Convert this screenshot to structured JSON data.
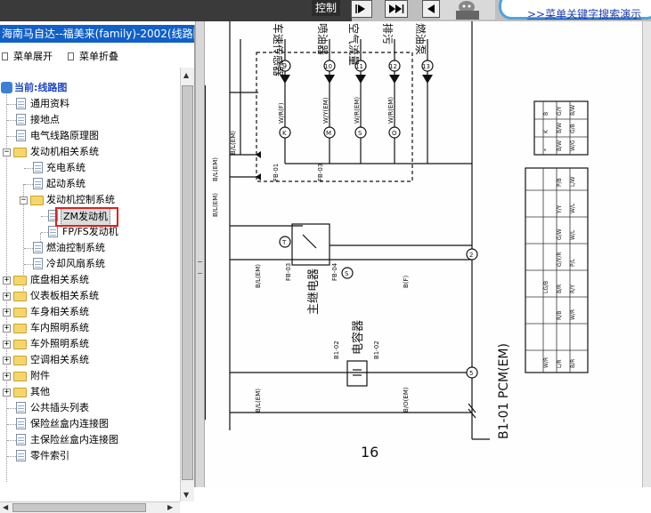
{
  "toolbar": {
    "control_label": "控制",
    "search_link": ">>菜单关键字搜索演示",
    "nav_icons": [
      "next-page-icon",
      "last-page-icon",
      "prev-page-icon"
    ]
  },
  "left_panel": {
    "title": "海南马自达--福美来(family)-2002(线路图)",
    "expand_label": "菜单展开",
    "collapse_label": "菜单折叠",
    "tree": {
      "root": "当前:线路图",
      "items": [
        {
          "label": "通用资料"
        },
        {
          "label": "接地点"
        },
        {
          "label": "电气线路原理图"
        },
        {
          "label": "发动机相关系统"
        },
        {
          "label": "充电系统"
        },
        {
          "label": "起动系统"
        },
        {
          "label": "发动机控制系统"
        },
        {
          "label": "ZM发动机"
        },
        {
          "label": "FP/FS发动机"
        },
        {
          "label": "燃油控制系统"
        },
        {
          "label": "冷却风扇系统"
        },
        {
          "label": "底盘相关系统"
        },
        {
          "label": "仪表板相关系统"
        },
        {
          "label": "车身相关系统"
        },
        {
          "label": "车内照明系统"
        },
        {
          "label": "车外照明系统"
        },
        {
          "label": "空调相关系统"
        },
        {
          "label": "附件"
        },
        {
          "label": "其他"
        },
        {
          "label": "公共插头列表"
        },
        {
          "label": "保险丝盒内连接图"
        },
        {
          "label": "主保险丝盒内连接图"
        },
        {
          "label": "零件索引"
        }
      ]
    }
  },
  "diagram": {
    "page_number": "16",
    "pcm_label": "B1-01 PCM(EM)",
    "relay_label": "主继电器",
    "capacitor_label": "电容器",
    "connectors": [
      "FB-01",
      "FB-03",
      "FB-04",
      "B1-02",
      "B1-02"
    ],
    "circles": [
      "9",
      "10",
      "11",
      "12",
      "13",
      "K",
      "M",
      "S",
      "O",
      "T",
      "S",
      "5",
      "2"
    ],
    "wire_labels": [
      "B/L(EM)",
      "B/L(EM)",
      "B/L(EM)",
      "B/L(EM)",
      "W/R(F)",
      "W/Y(EM)",
      "W/R(EM)",
      "W/R(EM)",
      "B(F)",
      "B/O(EM)",
      "B/L(EM)"
    ],
    "top_labels": [
      "车速传感器",
      "喷油器",
      "空气流量",
      "排污",
      "燃油泵"
    ],
    "pin_grid_1": [
      [
        "B",
        "G/Y",
        "B/W"
      ],
      [
        "K",
        "B/W",
        "G/B"
      ],
      [
        "*",
        "B/W",
        "W/G"
      ]
    ],
    "pin_grid_2": [
      [
        "P/B",
        "L/W"
      ],
      [
        "Y/Y",
        "W/L"
      ],
      [
        "G/W",
        "W/L"
      ],
      [
        "G/Y/R",
        "P/L"
      ],
      [
        "LG/B",
        "B/R",
        "R/Y"
      ],
      [
        "R/B",
        "W/R"
      ],
      [
        "W/R",
        "L/R",
        "B/R"
      ]
    ]
  }
}
